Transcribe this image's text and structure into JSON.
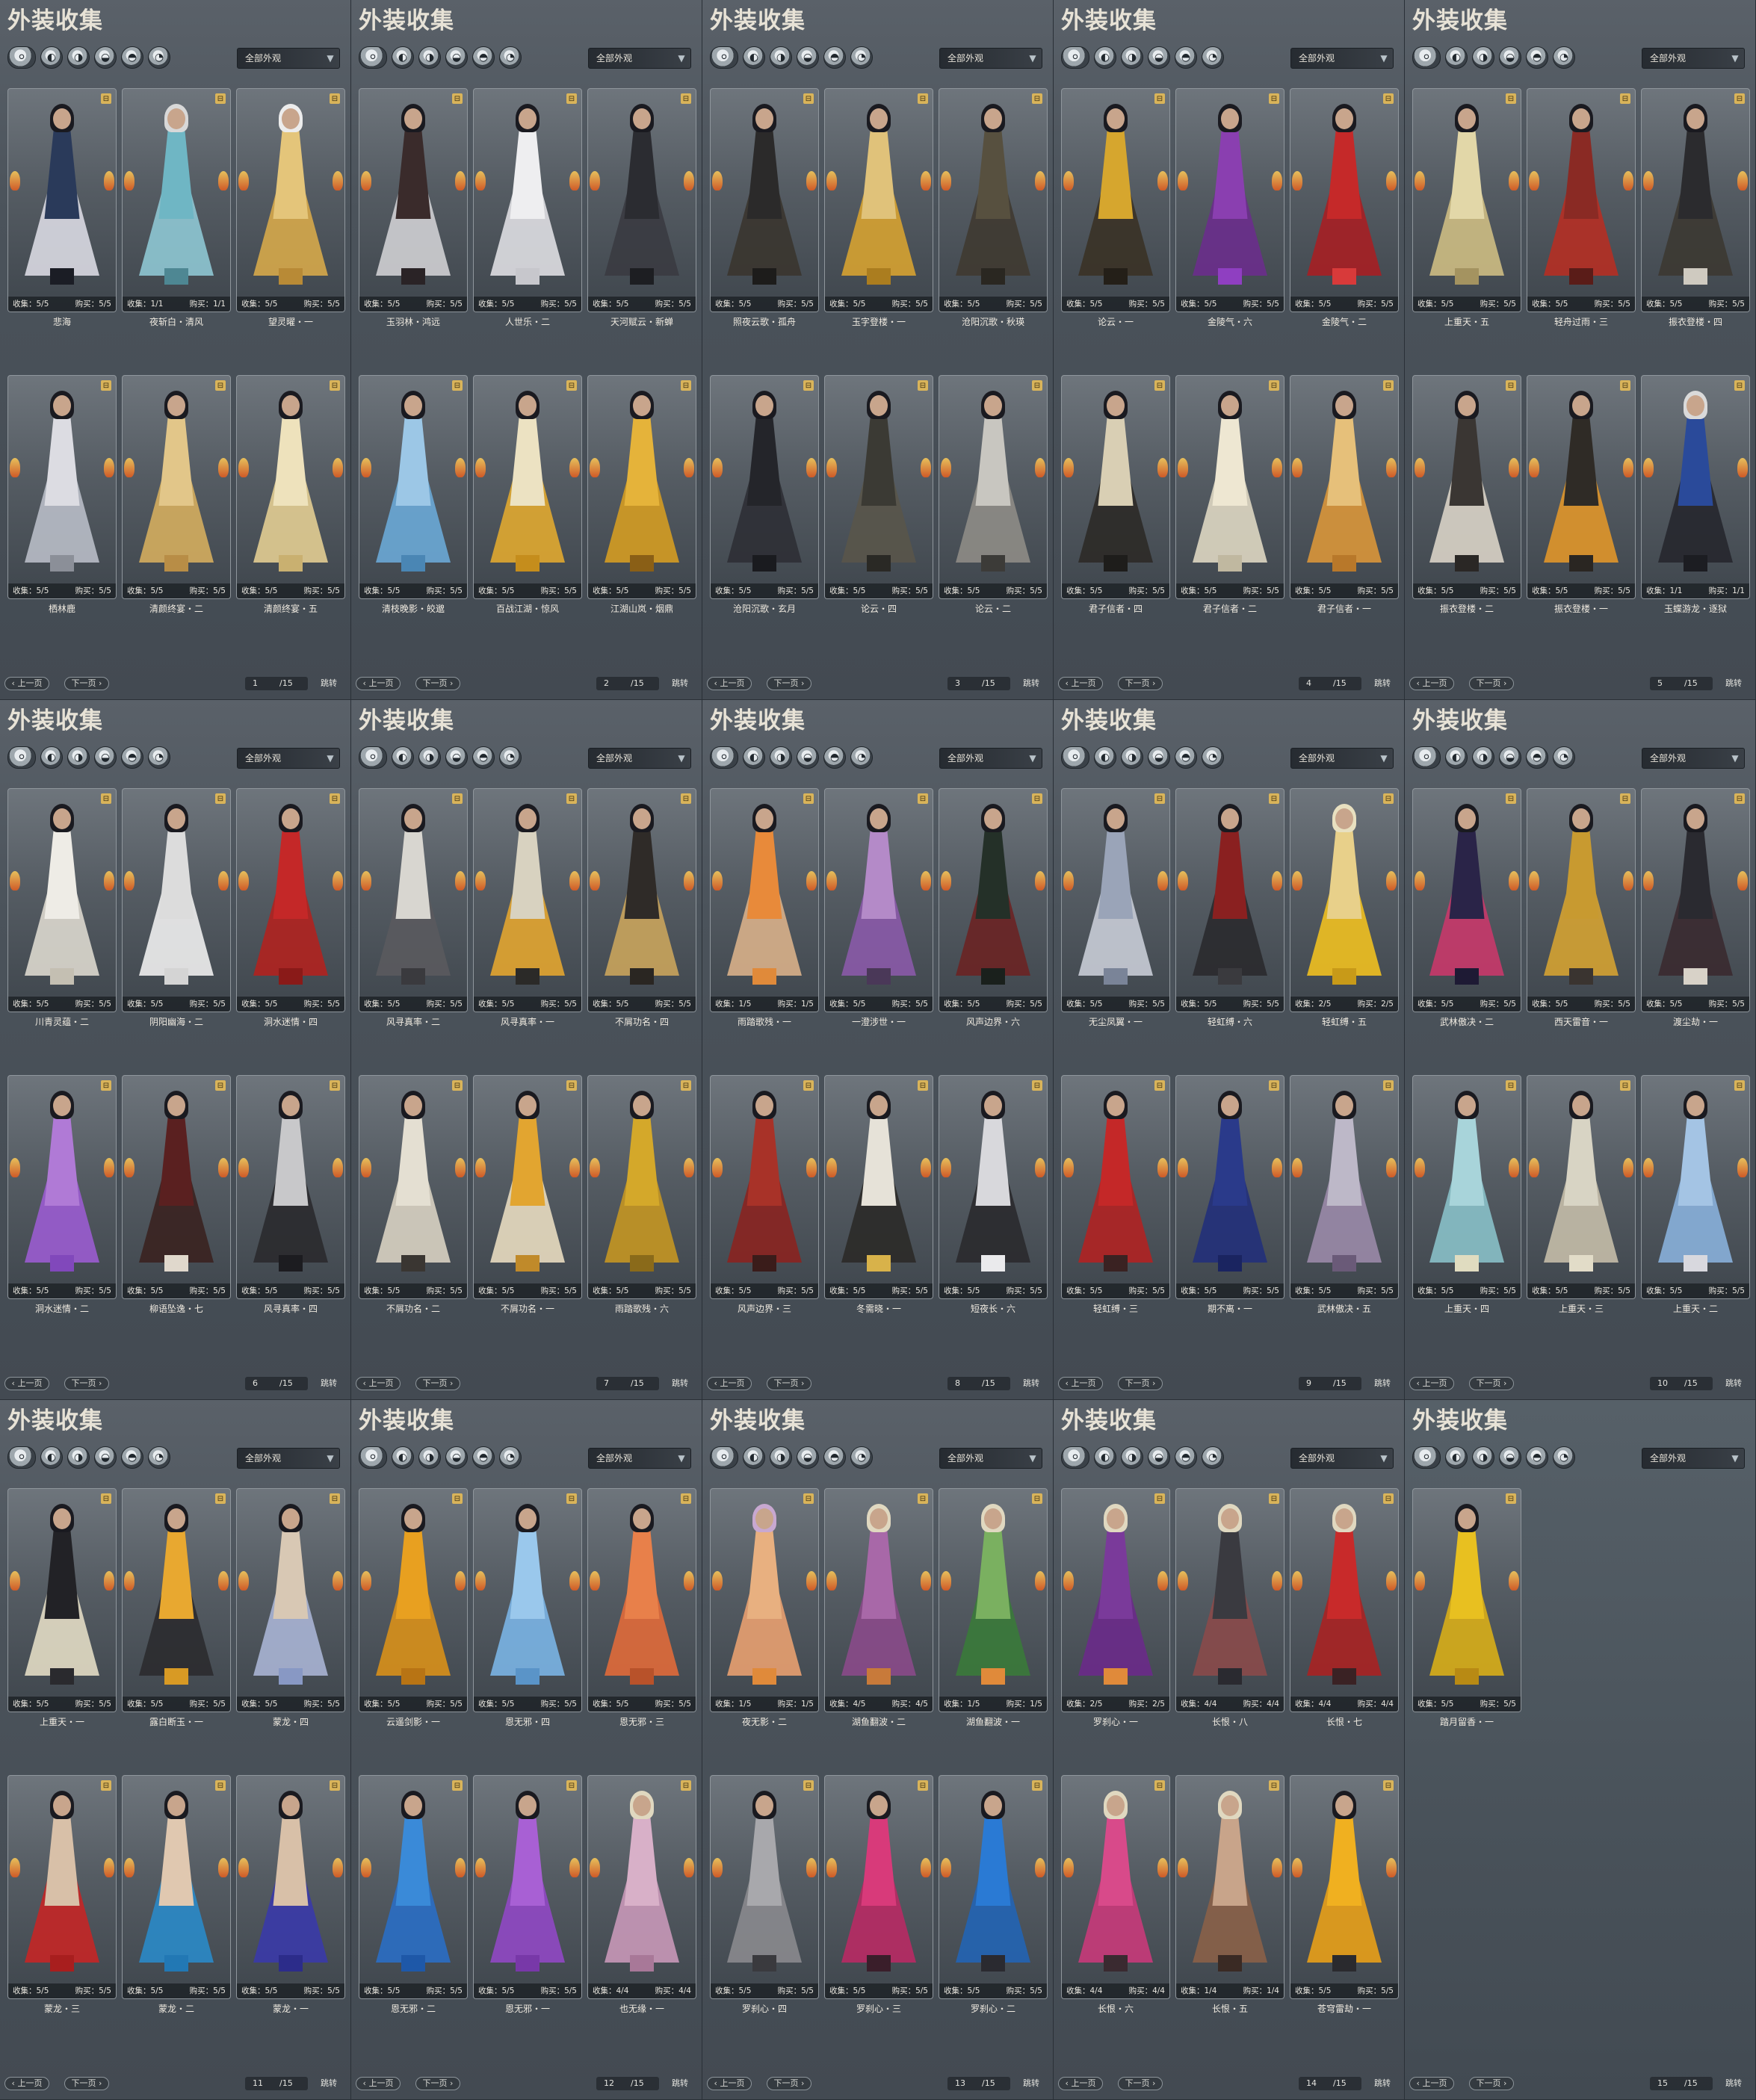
{
  "ui": {
    "title": "外装收集",
    "filter": "全部外观",
    "prev": "上一页",
    "next": "下一页",
    "jump": "跳转",
    "total": "/15",
    "collect_label": "收集",
    "buy_label": "购买"
  },
  "tab_icons": [
    "all-outfits-icon",
    "top-icon",
    "robe-icon",
    "accessory-icon",
    "shoes-icon",
    "item-icon"
  ],
  "panels": [
    {
      "page": "1",
      "cards": [
        {
          "name": "悲海",
          "collect": "5/5",
          "buy": "5/5",
          "hair": "#1a1a20",
          "top": "#2a3a5a",
          "robe": "#d9d9e2",
          "legs": "#1b1d25"
        },
        {
          "name": "夜斩白・清风",
          "collect": "1/1",
          "buy": "1/1",
          "hair": "#d8d8d8",
          "top": "#6fb6c4",
          "robe": "#8ec7d3",
          "legs": "#4e8793"
        },
        {
          "name": "望灵曜・一",
          "collect": "5/5",
          "buy": "5/5",
          "hair": "#ececec",
          "top": "#e4c57a",
          "robe": "#d6a84a",
          "legs": "#b88a36"
        },
        {
          "name": "栖林鹿",
          "collect": "5/5",
          "buy": "5/5",
          "hair": "#1a1a20",
          "top": "#dcdce2",
          "robe": "#b8bcc6",
          "legs": "#8b8f98"
        },
        {
          "name": "清颜终宴・二",
          "collect": "5/5",
          "buy": "5/5",
          "hair": "#1a1a20",
          "top": "#e2c689",
          "robe": "#d4ad5e",
          "legs": "#b88d46"
        },
        {
          "name": "清颜终宴・五",
          "collect": "5/5",
          "buy": "5/5",
          "hair": "#1a1a20",
          "top": "#eee2bc",
          "robe": "#e2cd92",
          "legs": "#c9b070"
        }
      ]
    },
    {
      "page": "2",
      "cards": [
        {
          "name": "玉羽林・鸿远",
          "collect": "5/5",
          "buy": "5/5",
          "hair": "#1a1a20",
          "top": "#3a2b2b",
          "robe": "#cfcfd3",
          "legs": "#2a2326"
        },
        {
          "name": "人世乐・二",
          "collect": "5/5",
          "buy": "5/5",
          "hair": "#1a1a20",
          "top": "#eeeef0",
          "robe": "#dedee2",
          "legs": "#c7c7cc"
        },
        {
          "name": "天河赋云・新蝉",
          "collect": "5/5",
          "buy": "5/5",
          "hair": "#1a1a20",
          "top": "#2b2c31",
          "robe": "#3a3b41",
          "legs": "#1d1e22"
        },
        {
          "name": "清枝晚影・皎邈",
          "collect": "5/5",
          "buy": "5/5",
          "hair": "#1a1a20",
          "top": "#9cc7e6",
          "robe": "#6aa8d6",
          "legs": "#4a86b4"
        },
        {
          "name": "百战江湖・惊风",
          "collect": "5/5",
          "buy": "5/5",
          "hair": "#1a1a20",
          "top": "#ece2c2",
          "robe": "#e0a830",
          "legs": "#c58d1c"
        },
        {
          "name": "江湖山岚・烟鼎",
          "collect": "5/5",
          "buy": "5/5",
          "hair": "#1a1a20",
          "top": "#e5b33a",
          "robe": "#d49c22",
          "legs": "#8a5f16"
        }
      ]
    },
    {
      "page": "3",
      "cards": [
        {
          "name": "照夜云歌・孤舟",
          "collect": "5/5",
          "buy": "5/5",
          "hair": "#1a1a20",
          "top": "#2b2a2a",
          "robe": "#3a352f",
          "legs": "#1d1c1b"
        },
        {
          "name": "玉字登楼・一",
          "collect": "5/5",
          "buy": "5/5",
          "hair": "#1a1a20",
          "top": "#e0c27a",
          "robe": "#d6a231",
          "legs": "#ab7d1f"
        },
        {
          "name": "沧阳沉歌・秋瑛",
          "collect": "5/5",
          "buy": "5/5",
          "hair": "#1a1a20",
          "top": "#57503f",
          "robe": "#3f3a31",
          "legs": "#2a2721"
        },
        {
          "name": "沧阳沉歌・玄月",
          "collect": "5/5",
          "buy": "5/5",
          "hair": "#1a1a20",
          "top": "#24252a",
          "robe": "#2e2f35",
          "legs": "#1a1b1f"
        },
        {
          "name": "论云・四",
          "collect": "5/5",
          "buy": "5/5",
          "hair": "#1a1a20",
          "top": "#3b3a34",
          "robe": "#59554a",
          "legs": "#2a2925"
        },
        {
          "name": "论云・二",
          "collect": "5/5",
          "buy": "5/5",
          "hair": "#1a1a20",
          "top": "#c8c6c0",
          "robe": "#8e8c86",
          "legs": "#3c3b38"
        }
      ]
    },
    {
      "page": "4",
      "cards": [
        {
          "name": "论云・一",
          "collect": "5/5",
          "buy": "5/5",
          "hair": "#1a1a20",
          "top": "#d6a62e",
          "robe": "#3a3226",
          "legs": "#241f18"
        },
        {
          "name": "金陵气・六",
          "collect": "5/5",
          "buy": "5/5",
          "hair": "#1a1a20",
          "top": "#8a3fb0",
          "robe": "#6a2d8c",
          "legs": "#8f3fc1"
        },
        {
          "name": "金陵气・二",
          "collect": "5/5",
          "buy": "5/5",
          "hair": "#1a1a20",
          "top": "#c52929",
          "robe": "#a61f24",
          "legs": "#d83a3a"
        },
        {
          "name": "君子信者・四",
          "collect": "5/5",
          "buy": "5/5",
          "hair": "#1a1a20",
          "top": "#d9cfb4",
          "robe": "#2c2a27",
          "legs": "#1e1d1b"
        },
        {
          "name": "君子信者・二",
          "collect": "5/5",
          "buy": "5/5",
          "hair": "#1a1a20",
          "top": "#eee7d2",
          "robe": "#ded7c2",
          "legs": "#c0b8a0"
        },
        {
          "name": "君子信者・一",
          "collect": "5/5",
          "buy": "5/5",
          "hair": "#1a1a20",
          "top": "#e6c07a",
          "robe": "#d9963a",
          "legs": "#b8782a"
        }
      ]
    },
    {
      "page": "5",
      "cards": [
        {
          "name": "上重天・五",
          "collect": "5/5",
          "buy": "5/5",
          "hair": "#1a1a20",
          "top": "#e2d7a8",
          "robe": "#cdbd83",
          "legs": "#a49360"
        },
        {
          "name": "轻舟过雨・三",
          "collect": "5/5",
          "buy": "5/5",
          "hair": "#1a1a20",
          "top": "#8a2a24",
          "robe": "#b52f24",
          "legs": "#5a1c18"
        },
        {
          "name": "振衣登楼・四",
          "collect": "5/5",
          "buy": "5/5",
          "hair": "#1a1a20",
          "top": "#2b2b2e",
          "robe": "#3c3832",
          "legs": "#cfcac0"
        },
        {
          "name": "振衣登楼・二",
          "collect": "5/5",
          "buy": "5/5",
          "hair": "#1a1a20",
          "top": "#3a3633",
          "robe": "#d9d3c6",
          "legs": "#2a2725"
        },
        {
          "name": "振衣登楼・一",
          "collect": "5/5",
          "buy": "5/5",
          "hair": "#1a1a20",
          "top": "#2f2b26",
          "robe": "#e0962a",
          "legs": "#2a2622"
        },
        {
          "name": "玉蝶游龙・逐狱",
          "collect": "1/1",
          "buy": "1/1",
          "hair": "#dadada",
          "top": "#2a4a9a",
          "robe": "#26272d",
          "legs": "#1c1d22"
        }
      ]
    },
    {
      "page": "6",
      "cards": [
        {
          "name": "川青灵蕴・二",
          "collect": "5/5",
          "buy": "5/5",
          "hair": "#1a1a20",
          "top": "#eeece6",
          "robe": "#dcd8ce",
          "legs": "#c4bfb2"
        },
        {
          "name": "阴阳幽海・二",
          "collect": "5/5",
          "buy": "5/5",
          "hair": "#1a1a20",
          "top": "#dcdcdc",
          "robe": "#eeeeee",
          "legs": "#d4d4d4"
        },
        {
          "name": "洞水迷情・四",
          "collect": "5/5",
          "buy": "5/5",
          "hair": "#1a1a20",
          "top": "#c42828",
          "robe": "#b0221f",
          "legs": "#8a1a18"
        },
        {
          "name": "洞水迷情・二",
          "collect": "5/5",
          "buy": "5/5",
          "hair": "#1a1a20",
          "top": "#b07ad6",
          "robe": "#9a5cd0",
          "legs": "#8148bb"
        },
        {
          "name": "柳语坠逸・七",
          "collect": "5/5",
          "buy": "5/5",
          "hair": "#1a1a20",
          "top": "#5a2020",
          "robe": "#3a2220",
          "legs": "#e0d8cc"
        },
        {
          "name": "风寻真率・四",
          "collect": "5/5",
          "buy": "5/5",
          "hair": "#1a1a20",
          "top": "#c8c8ca",
          "robe": "#2a2a2e",
          "legs": "#1c1c20"
        }
      ]
    },
    {
      "page": "7",
      "cards": [
        {
          "name": "风寻真率・二",
          "collect": "5/5",
          "buy": "5/5",
          "hair": "#1a1a20",
          "top": "#d8d6d0",
          "robe": "#5a5a5e",
          "legs": "#3a3a3e"
        },
        {
          "name": "风寻真率・一",
          "collect": "5/5",
          "buy": "5/5",
          "hair": "#1a1a20",
          "top": "#d8d2c0",
          "robe": "#e2a530",
          "legs": "#2b2a28"
        },
        {
          "name": "不屑功名・四",
          "collect": "5/5",
          "buy": "5/5",
          "hair": "#1a1a20",
          "top": "#2f2b28",
          "robe": "#c9a45c",
          "legs": "#2a2622"
        },
        {
          "name": "不屑功名・二",
          "collect": "5/5",
          "buy": "5/5",
          "hair": "#1a1a20",
          "top": "#e4dfd2",
          "robe": "#d8d2c2",
          "legs": "#3a3632"
        },
        {
          "name": "不屑功名・一",
          "collect": "5/5",
          "buy": "5/5",
          "hair": "#1a1a20",
          "top": "#e2a530",
          "robe": "#e8dcc0",
          "legs": "#c08a2a"
        },
        {
          "name": "雨踏歌残・六",
          "collect": "5/5",
          "buy": "5/5",
          "hair": "#1a1a20",
          "top": "#d4a82a",
          "robe": "#c49622",
          "legs": "#8a6a1a"
        }
      ]
    },
    {
      "page": "8",
      "cards": [
        {
          "name": "雨踏歌残・一",
          "collect": "1/5",
          "buy": "1/5",
          "hair": "#1a1a20",
          "top": "#e88a3a",
          "robe": "#d8b08a",
          "legs": "#e08a3a"
        },
        {
          "name": "一澄涉世・一",
          "collect": "5/5",
          "buy": "5/5",
          "hair": "#1a1a20",
          "top": "#b48ac8",
          "robe": "#8a5aa8",
          "legs": "#4a3858"
        },
        {
          "name": "风声边界・六",
          "collect": "5/5",
          "buy": "5/5",
          "hair": "#1a1a20",
          "top": "#243028",
          "robe": "#6a2424",
          "legs": "#1a201c"
        },
        {
          "name": "风声边界・三",
          "collect": "5/5",
          "buy": "5/5",
          "hair": "#1a1a20",
          "top": "#a83228",
          "robe": "#8a2420",
          "legs": "#3a1c1a"
        },
        {
          "name": "冬需晓・一",
          "collect": "5/5",
          "buy": "5/5",
          "hair": "#1a1a20",
          "top": "#e6e2d8",
          "robe": "#2b2a28",
          "legs": "#d8b24a"
        },
        {
          "name": "短夜长・六",
          "collect": "5/5",
          "buy": "5/5",
          "hair": "#1a1a20",
          "top": "#d8d8dc",
          "robe": "#2a2a2e",
          "legs": "#eaeaec"
        }
      ]
    },
    {
      "page": "9",
      "cards": [
        {
          "name": "无尘凤翼・一",
          "collect": "5/5",
          "buy": "5/5",
          "hair": "#1a1a20",
          "top": "#9aa4b8",
          "robe": "#c8ccd6",
          "legs": "#7a8498"
        },
        {
          "name": "轻虹缚・六",
          "collect": "5/5",
          "buy": "5/5",
          "hair": "#1a1a20",
          "top": "#8a2020",
          "robe": "#2a2a2e",
          "legs": "#3a3a3e"
        },
        {
          "name": "轻虹缚・五",
          "collect": "2/5",
          "buy": "2/5",
          "hair": "#e8e0c0",
          "top": "#e8d08a",
          "robe": "#f0c020",
          "legs": "#c89a18"
        },
        {
          "name": "轻虹缚・三",
          "collect": "5/5",
          "buy": "5/5",
          "hair": "#1a1a20",
          "top": "#c42828",
          "robe": "#b02222",
          "legs": "#3a2222"
        },
        {
          "name": "期不离・一",
          "collect": "5/5",
          "buy": "5/5",
          "hair": "#1a1a20",
          "top": "#2a3a8a",
          "robe": "#22307a",
          "legs": "#1a2460"
        },
        {
          "name": "武林傲决・五",
          "collect": "5/5",
          "buy": "5/5",
          "hair": "#1a1a20",
          "top": "#bdb8c8",
          "robe": "#9a8aa8",
          "legs": "#6a5a78"
        }
      ]
    },
    {
      "page": "10",
      "cards": [
        {
          "name": "武林傲决・二",
          "collect": "5/5",
          "buy": "5/5",
          "hair": "#1a1a20",
          "top": "#2a2448",
          "robe": "#c8386a",
          "legs": "#1e1a34"
        },
        {
          "name": "西天雷音・一",
          "collect": "5/5",
          "buy": "5/5",
          "hair": "#1a1a20",
          "top": "#c89a30",
          "robe": "#d4a232",
          "legs": "#3a3430"
        },
        {
          "name": "渡尘劫・一",
          "collect": "5/5",
          "buy": "5/5",
          "hair": "#1a1a20",
          "top": "#2a2a30",
          "robe": "#3a2a30",
          "legs": "#d8d2c8"
        },
        {
          "name": "上重天・四",
          "collect": "5/5",
          "buy": "5/5",
          "hair": "#1a1a20",
          "top": "#a8d4da",
          "robe": "#88c0c8",
          "legs": "#e0dcc0"
        },
        {
          "name": "上重天・三",
          "collect": "5/5",
          "buy": "5/5",
          "hair": "#1a1a20",
          "top": "#d8d4c4",
          "robe": "#c4bca8",
          "legs": "#e2dcc8"
        },
        {
          "name": "上重天・二",
          "collect": "5/5",
          "buy": "5/5",
          "hair": "#1a1a20",
          "top": "#a4c4e4",
          "robe": "#88b0da",
          "legs": "#d8d8de"
        }
      ]
    },
    {
      "page": "11",
      "cards": [
        {
          "name": "上重天・一",
          "collect": "5/5",
          "buy": "5/5",
          "hair": "#1a1a20",
          "top": "#222226",
          "robe": "#e2dcc4",
          "legs": "#2a2a2e"
        },
        {
          "name": "露白断玉・一",
          "collect": "5/5",
          "buy": "5/5",
          "hair": "#1a1a20",
          "top": "#e8a830",
          "robe": "#2b2b2f",
          "legs": "#d89a24"
        },
        {
          "name": "蒙龙・四",
          "collect": "5/5",
          "buy": "5/5",
          "hair": "#1a1a20",
          "top": "#d8c8b4",
          "robe": "#a8b4d4",
          "legs": "#8898c4"
        },
        {
          "name": "蒙龙・三",
          "collect": "5/5",
          "buy": "5/5",
          "hair": "#1a1a20",
          "top": "#d8c0a8",
          "robe": "#c42626",
          "legs": "#a81e1e"
        },
        {
          "name": "蒙龙・二",
          "collect": "5/5",
          "buy": "5/5",
          "hair": "#1a1a20",
          "top": "#e0c8b0",
          "robe": "#2a8ac8",
          "legs": "#2278b4"
        },
        {
          "name": "蒙龙・一",
          "collect": "5/5",
          "buy": "5/5",
          "hair": "#1a1a20",
          "top": "#d8c0a8",
          "robe": "#3a3aa8",
          "legs": "#2c2c8a"
        }
      ]
    },
    {
      "page": "12",
      "cards": [
        {
          "name": "云遥剑影・一",
          "collect": "5/5",
          "buy": "5/5",
          "hair": "#1a1a20",
          "top": "#e8a020",
          "robe": "#d8901a",
          "legs": "#b87414"
        },
        {
          "name": "恩无邪・四",
          "collect": "5/5",
          "buy": "5/5",
          "hair": "#1a1a20",
          "top": "#9ac8ec",
          "robe": "#7ab4e4",
          "legs": "#5a94c8"
        },
        {
          "name": "恩无邪・三",
          "collect": "5/5",
          "buy": "5/5",
          "hair": "#1a1a20",
          "top": "#e8804a",
          "robe": "#e06a3a",
          "legs": "#b8522a"
        },
        {
          "name": "恩无邪・二",
          "collect": "5/5",
          "buy": "5/5",
          "hair": "#1a1a20",
          "top": "#3a8ad8",
          "robe": "#2a6ec4",
          "legs": "#1e58a8"
        },
        {
          "name": "恩无邪・一",
          "collect": "5/5",
          "buy": "5/5",
          "hair": "#1a1a20",
          "top": "#a860d4",
          "robe": "#9048c4",
          "legs": "#7838a8"
        },
        {
          "name": "也无缘・一",
          "collect": "4/4",
          "buy": "4/4",
          "hair": "#e0d8c0",
          "top": "#d8b0c8",
          "robe": "#c898b8",
          "legs": "#a87898"
        }
      ]
    },
    {
      "page": "13",
      "cards": [
        {
          "name": "夜无影・二",
          "collect": "1/5",
          "buy": "1/5",
          "hair": "#c8a8d0",
          "top": "#e8b080",
          "robe": "#e8a070",
          "legs": "#e08a3a"
        },
        {
          "name": "湖鱼翻波・二",
          "collect": "4/5",
          "buy": "4/5",
          "hair": "#e0d8c0",
          "top": "#a868a8",
          "robe": "#8a4a8a",
          "legs": "#c87a3a"
        },
        {
          "name": "湖鱼翻波・一",
          "collect": "1/5",
          "buy": "1/5",
          "hair": "#e0d8c0",
          "top": "#7ab060",
          "robe": "#3a7a3a",
          "legs": "#e08a3a"
        },
        {
          "name": "罗刹心・四",
          "collect": "5/5",
          "buy": "5/5",
          "hair": "#1a1a20",
          "top": "#a8a8ac",
          "robe": "#8a8a8e",
          "legs": "#3a3a3e"
        },
        {
          "name": "罗刹心・三",
          "collect": "5/5",
          "buy": "5/5",
          "hair": "#1a1a20",
          "top": "#d83a7a",
          "robe": "#b82a64",
          "legs": "#3a1e2a"
        },
        {
          "name": "罗刹心・二",
          "collect": "5/5",
          "buy": "5/5",
          "hair": "#1a1a20",
          "top": "#2a7ad4",
          "robe": "#2264b4",
          "legs": "#2a2a30"
        }
      ]
    },
    {
      "page": "14",
      "cards": [
        {
          "name": "罗刹心・一",
          "collect": "2/5",
          "buy": "2/5",
          "hair": "#e0d8c0",
          "top": "#7a3a9a",
          "robe": "#6a2a8a",
          "legs": "#e08a3a"
        },
        {
          "name": "长恨・八",
          "collect": "4/4",
          "buy": "4/4",
          "hair": "#e0d8c0",
          "top": "#3a3a40",
          "robe": "#8a4a4a",
          "legs": "#2a2a30"
        },
        {
          "name": "长恨・七",
          "collect": "4/4",
          "buy": "4/4",
          "hair": "#e0d8c0",
          "top": "#c82a2a",
          "robe": "#a82222",
          "legs": "#3a2224"
        },
        {
          "name": "长恨・六",
          "collect": "4/4",
          "buy": "4/4",
          "hair": "#e0d8c0",
          "top": "#d84a8a",
          "robe": "#c83a7a",
          "legs": "#3a2a30"
        },
        {
          "name": "长恨・五",
          "collect": "1/4",
          "buy": "1/4",
          "hair": "#e0d8c0",
          "top": "#c8a48a",
          "robe": "#8a6048",
          "legs": "#3a2a24"
        },
        {
          "name": "苍穹雷劫・一",
          "collect": "5/5",
          "buy": "5/5",
          "hair": "#1a1a20",
          "top": "#f0b020",
          "robe": "#e8a018",
          "legs": "#2a2a2e"
        }
      ]
    },
    {
      "page": "15",
      "cards": [
        {
          "name": "踏月留香・一",
          "collect": "5/5",
          "buy": "5/5",
          "hair": "#1a1a20",
          "top": "#e8c020",
          "robe": "#d8ae18",
          "legs": "#b88a14"
        }
      ]
    }
  ]
}
